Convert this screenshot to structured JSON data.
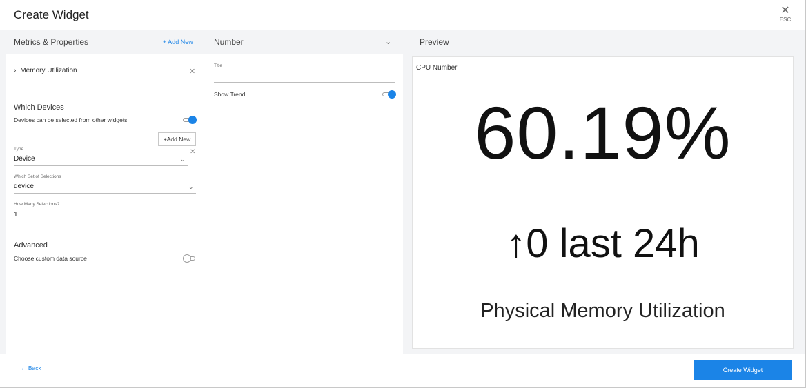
{
  "header": {
    "title": "Create Widget",
    "close_icon": "close-icon",
    "close_hint": "ESC"
  },
  "columns": {
    "metrics_title": "Metrics & Properties",
    "add_new_link": "+ Add New",
    "widget_type_value": "Number",
    "preview_title": "Preview"
  },
  "metrics": {
    "items": [
      {
        "label": "Memory Utilization",
        "expand_icon": "chevron-right-icon",
        "remove_icon": "close-icon"
      }
    ]
  },
  "devices": {
    "section_title": "Which Devices",
    "select_from_others_label": "Devices can be selected from other widgets",
    "select_from_others_on": true,
    "add_new_button": "+Add New",
    "type_caption": "Type",
    "type_value": "Device",
    "selection_set_caption": "Which Set of Selections",
    "selection_set_value": "device",
    "how_many_caption": "How Many Selections?",
    "how_many_value": "1"
  },
  "advanced": {
    "section_title": "Advanced",
    "custom_source_label": "Choose custom data source",
    "custom_source_on": false
  },
  "settings": {
    "title_caption": "Title",
    "title_value": "",
    "show_trend_label": "Show Trend",
    "show_trend_on": true
  },
  "preview": {
    "widget_title": "CPU Number",
    "value": "60.19%",
    "trend": "↑0 last 24h",
    "description": "Physical Memory Utilization"
  },
  "footer": {
    "back_label": "← Back",
    "create_label": "Create Widget"
  },
  "colors": {
    "accent": "#1b84e7",
    "panel_bg": "#f3f4f6",
    "border": "#c8c8c8"
  }
}
